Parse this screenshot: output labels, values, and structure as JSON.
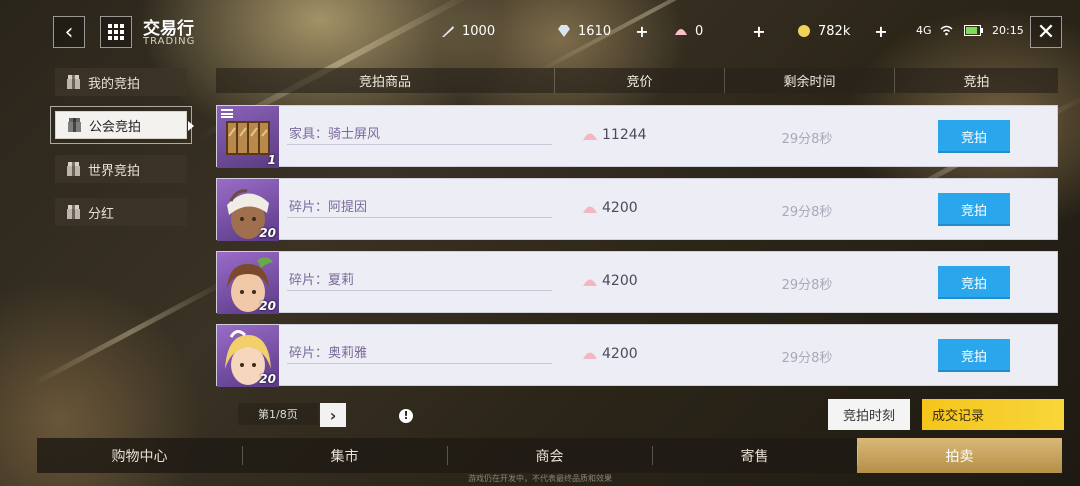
{
  "header": {
    "title_zh": "交易行",
    "title_en": "TRADING"
  },
  "resources": [
    {
      "icon": "feather-icon",
      "value": "1000"
    },
    {
      "icon": "diamond-icon",
      "value": "1610"
    },
    {
      "icon": "shell-icon",
      "value": "0"
    },
    {
      "icon": "gold-coin-icon",
      "value": "782k"
    }
  ],
  "plus_label": "+",
  "status": {
    "network": "4G",
    "time": "20:15"
  },
  "sidebar": {
    "items": [
      {
        "label": "我的竞拍"
      },
      {
        "label": "公会竞拍"
      },
      {
        "label": "世界竞拍"
      },
      {
        "label": "分红"
      }
    ],
    "active_index": 1
  },
  "table": {
    "headers": [
      "竞拍商品",
      "竞价",
      "剩余时间",
      "竞拍"
    ],
    "rows": [
      {
        "name": "家具：骑士屏风",
        "price": "11244",
        "time": "29分8秒",
        "count": "1",
        "action": "竞拍"
      },
      {
        "name": "碎片：阿提因",
        "price": "4200",
        "time": "29分8秒",
        "count": "20",
        "action": "竞拍"
      },
      {
        "name": "碎片：夏莉",
        "price": "4200",
        "time": "29分8秒",
        "count": "20",
        "action": "竞拍"
      },
      {
        "name": "碎片：奥莉雅",
        "price": "4200",
        "time": "29分8秒",
        "count": "20",
        "action": "竞拍"
      }
    ]
  },
  "pager": {
    "label": "第1/8页",
    "next": "›"
  },
  "info_label": "!",
  "actions": {
    "bid_time": "竞拍时刻",
    "records": "成交记录"
  },
  "bottom_nav": {
    "items": [
      "购物中心",
      "集市",
      "商会",
      "寄售",
      "拍卖"
    ],
    "active_index": 4
  },
  "footnote": "游戏仍在开发中，不代表最终品质和效果",
  "colors": {
    "accent_blue": "#29a6ec",
    "accent_yellow": "#f5c51c",
    "active_tab_gold": "#c9a35e"
  }
}
